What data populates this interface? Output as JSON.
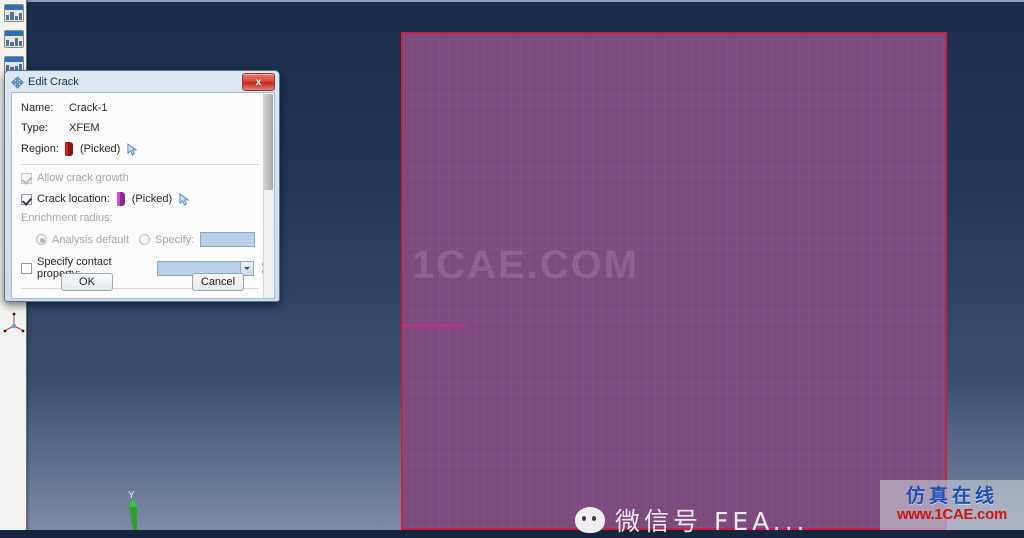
{
  "app": {
    "background_top_color": "#1b2d4a",
    "background_bottom_color": "#7d8ba4"
  },
  "sidebar": {
    "items": [
      {
        "name": "model-tree-icon-1"
      },
      {
        "name": "model-tree-icon-2"
      },
      {
        "name": "model-tree-icon-3"
      }
    ],
    "triad_icon": "axis-triad-icon"
  },
  "viewport": {
    "part_name": "xfem-plate",
    "part_fill_color": "#7c4a7c",
    "part_edge_color": "#c0234a",
    "crack_line_color": "#e0218a",
    "watermark": "1CAE.COM",
    "axis_label_y": "Y",
    "axis_arrow_color": "#2fa02f"
  },
  "branding": {
    "wechat_text": "微信号 FEA...",
    "logo_cn": "仿真在线",
    "logo_url": "www.1CAE.com",
    "logo_cn_color": "#1f4fb5",
    "logo_url_color": "#d01414"
  },
  "dialog": {
    "title": "Edit Crack",
    "close_label": "x",
    "fields": {
      "name_label": "Name:",
      "name_value": "Crack-1",
      "type_label": "Type:",
      "type_value": "XFEM",
      "region_label": "Region:",
      "region_value": "(Picked)",
      "allow_growth_label": "Allow crack growth",
      "allow_growth_checked": true,
      "allow_growth_enabled": false,
      "crack_location_label": "Crack location:",
      "crack_location_value": "(Picked)",
      "crack_location_checked": true,
      "enrichment_radius_label": "Enrichment radius:",
      "analysis_default_label": "Analysis default",
      "analysis_default_selected": true,
      "specify_label": "Specify:",
      "specify_value": "",
      "specify_selected": false,
      "contact_property_label": "Specify contact property:",
      "contact_property_checked": false,
      "contact_property_value": ""
    },
    "buttons": {
      "ok": "OK",
      "cancel": "Cancel"
    }
  }
}
